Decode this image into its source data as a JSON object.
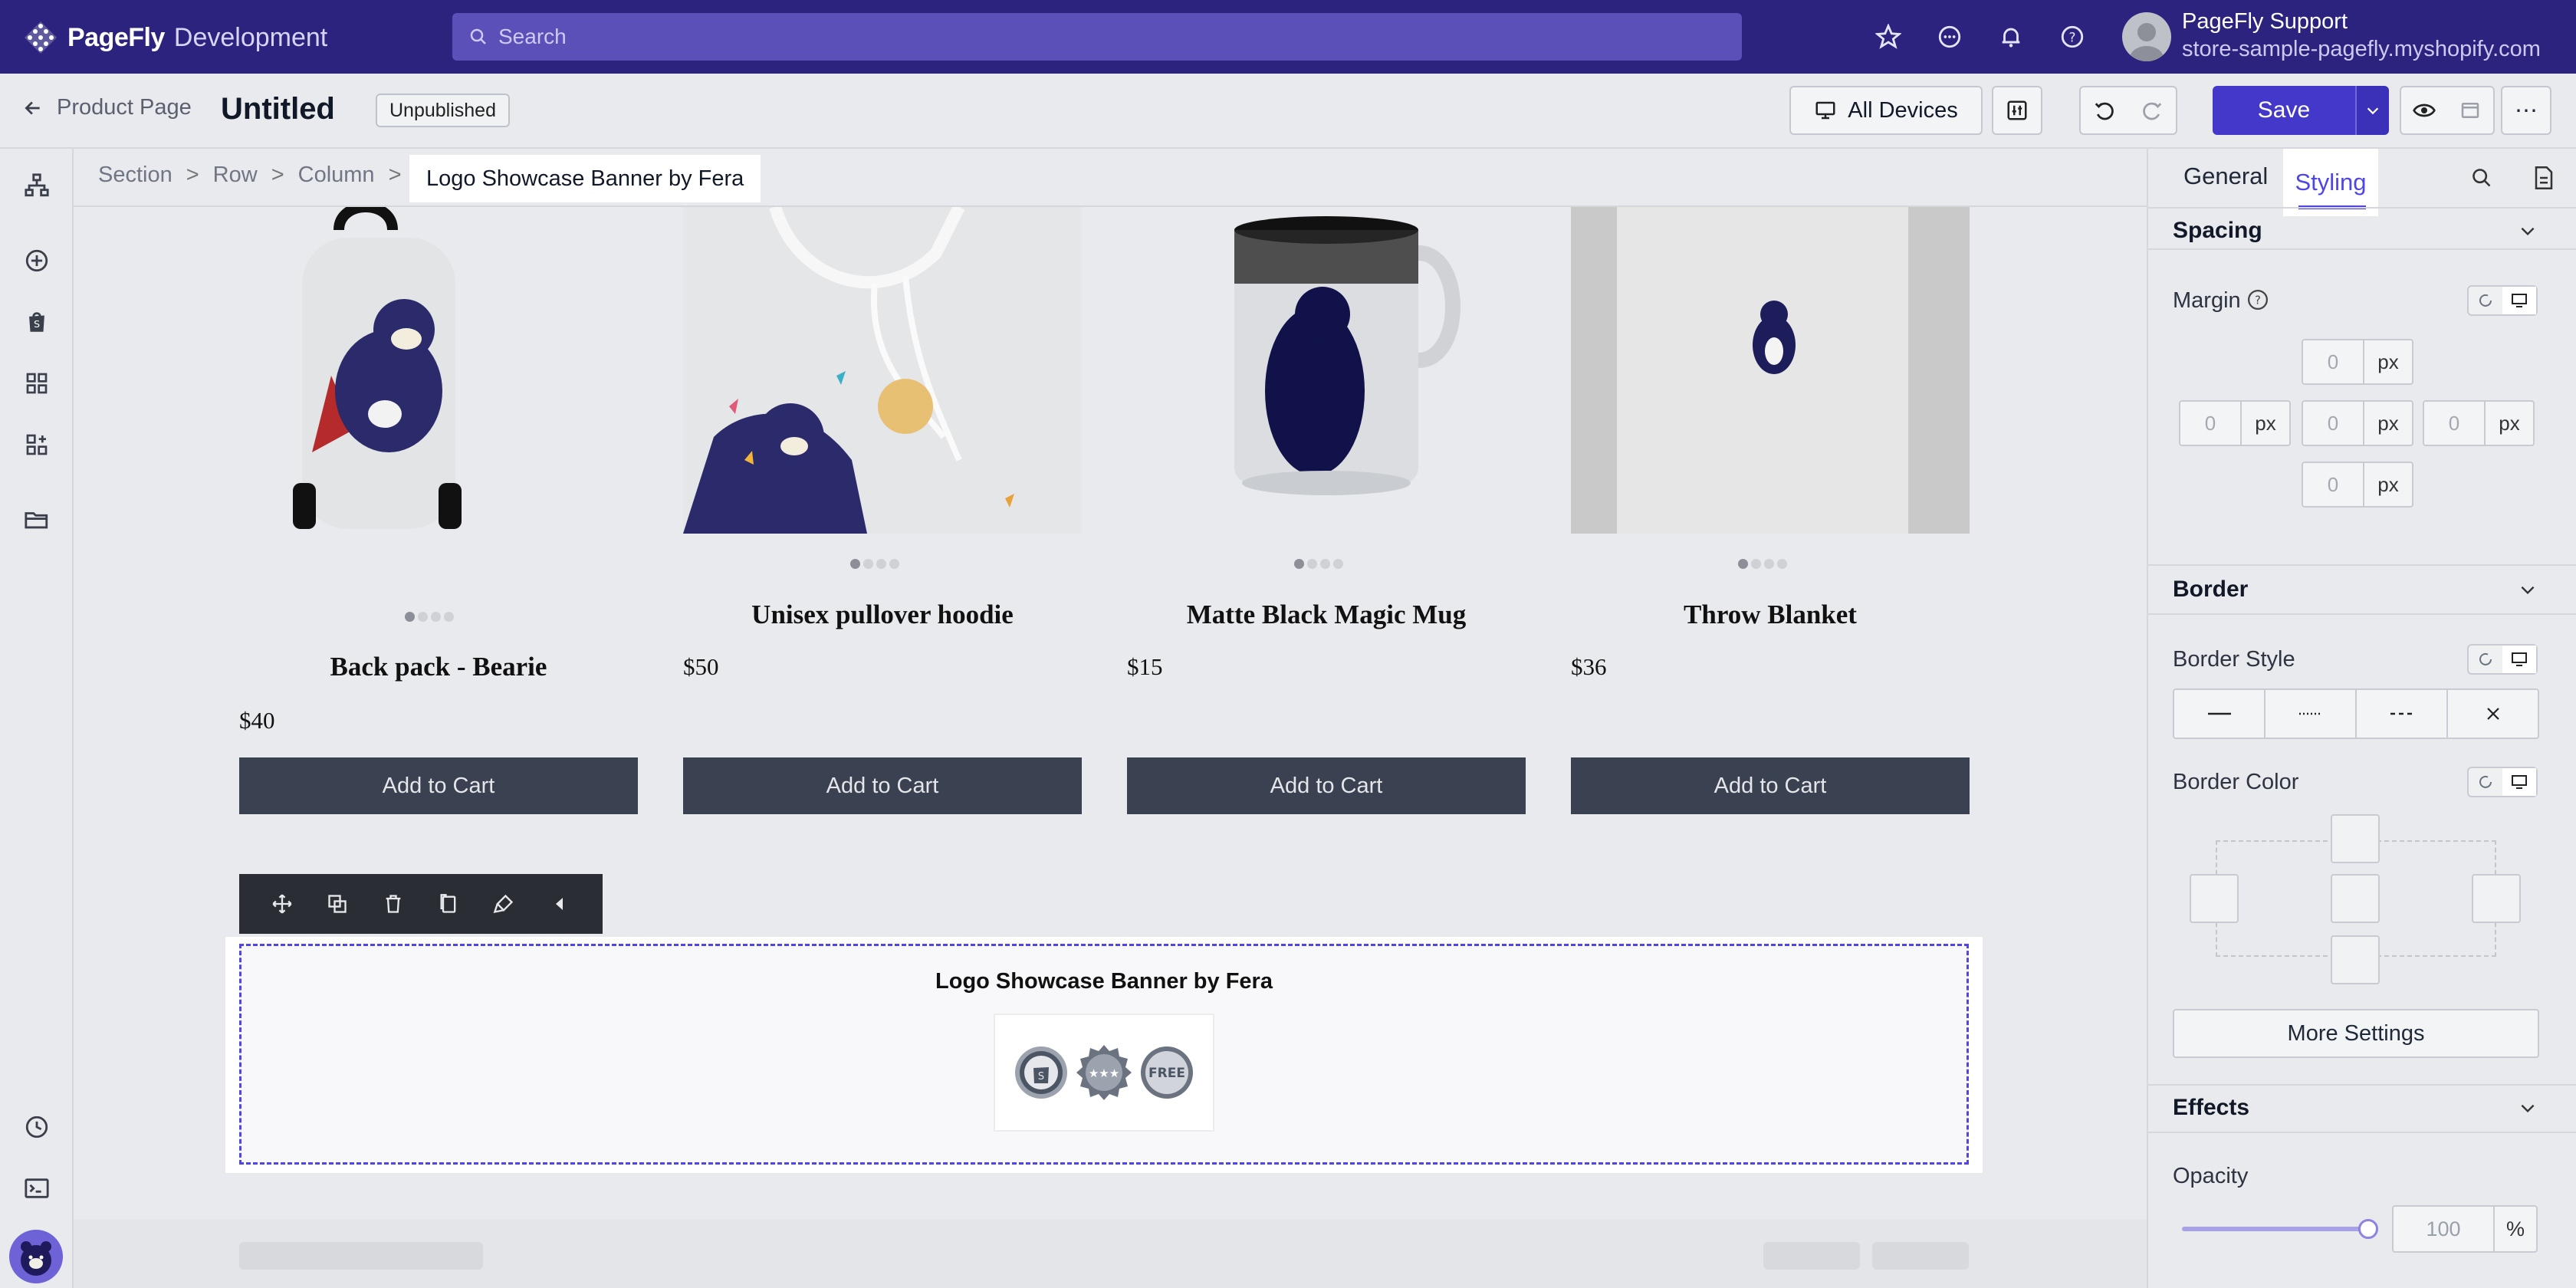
{
  "topbar": {
    "brand": "PageFly",
    "environment": "Development",
    "search_placeholder": "Search",
    "user_name": "PageFly Support",
    "store": "store-sample-pagefly.myshopify.com",
    "icons": [
      "star-icon",
      "chat-icon",
      "bell-icon",
      "help-icon"
    ]
  },
  "header": {
    "back_label": "Product Page",
    "title": "Untitled",
    "status": "Unpublished",
    "devices_label": "All Devices",
    "save_label": "Save",
    "more_label": "⋯"
  },
  "breadcrumb": {
    "items": [
      "Section",
      "Row",
      "Column"
    ],
    "active": "Logo Showcase Banner by Fera",
    "separator": ">"
  },
  "products": [
    {
      "name": "Back pack - Bearie",
      "price": "$40",
      "cta": "Add to Cart"
    },
    {
      "name": "Unisex pullover hoodie",
      "price": "$50",
      "cta": "Add to Cart"
    },
    {
      "name": "Matte Black Magic Mug",
      "price": "$15",
      "cta": "Add to Cart"
    },
    {
      "name": "Throw Blanket",
      "price": "$36",
      "cta": "Add to Cart"
    }
  ],
  "selected_section": {
    "title": "Logo Showcase Banner by Fera",
    "badges": [
      "shopify-badge",
      "rating-badge",
      "free-badge"
    ],
    "badge_free_text": "FREE"
  },
  "panel": {
    "tabs": [
      "General",
      "Styling"
    ],
    "active_tab": "Styling",
    "spacing": {
      "heading": "Spacing",
      "margin_label": "Margin",
      "top": "0",
      "left": "0",
      "center": "0",
      "right": "0",
      "bottom": "0",
      "unit": "px"
    },
    "border": {
      "heading": "Border",
      "style_label": "Border Style",
      "color_label": "Border Color",
      "more_settings": "More Settings"
    },
    "effects": {
      "heading": "Effects",
      "opacity_label": "Opacity",
      "opacity_value": "100",
      "opacity_unit": "%",
      "opacity_level": 1.0
    }
  },
  "colors": {
    "topbar": "#2b237e",
    "accent": "#4f46e5",
    "button_dark": "#3a4150"
  }
}
